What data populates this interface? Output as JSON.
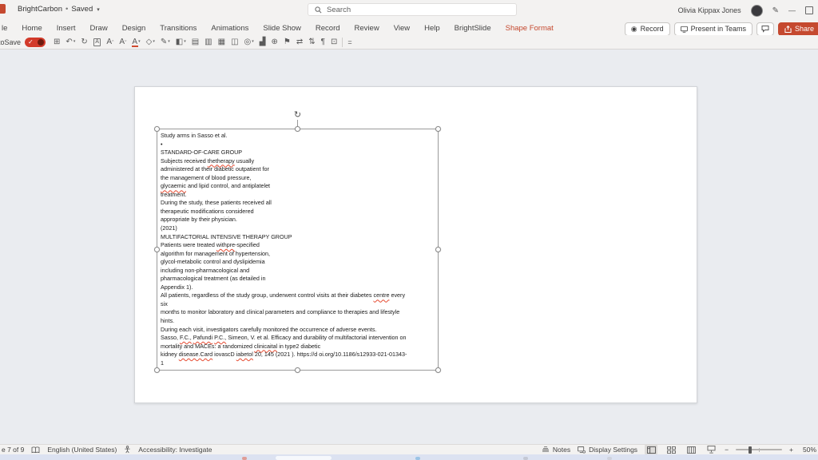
{
  "titlebar": {
    "doc_name": "BrightCarbon",
    "separator": "•",
    "saved_status": "Saved",
    "search_placeholder": "Search",
    "user_name": "Olivia Kippax Jones"
  },
  "ribbon": {
    "tabs": [
      {
        "label": "le",
        "name": "tab-file"
      },
      {
        "label": "Home",
        "name": "tab-home"
      },
      {
        "label": "Insert",
        "name": "tab-insert"
      },
      {
        "label": "Draw",
        "name": "tab-draw"
      },
      {
        "label": "Design",
        "name": "tab-design"
      },
      {
        "label": "Transitions",
        "name": "tab-transitions"
      },
      {
        "label": "Animations",
        "name": "tab-animations"
      },
      {
        "label": "Slide Show",
        "name": "tab-slide-show"
      },
      {
        "label": "Record",
        "name": "tab-record"
      },
      {
        "label": "Review",
        "name": "tab-review"
      },
      {
        "label": "View",
        "name": "tab-view"
      },
      {
        "label": "Help",
        "name": "tab-help"
      },
      {
        "label": "BrightSlide",
        "name": "tab-brightslide"
      },
      {
        "label": "Shape Format",
        "name": "tab-shape-format",
        "accent": true
      }
    ],
    "record_label": "Record",
    "present_label": "Present in Teams",
    "share_label": "Share"
  },
  "qat": {
    "autosave_label": "toSave",
    "overflow_glyph": "=",
    "icons": [
      {
        "name": "paste-icon",
        "glyph": "⊞"
      },
      {
        "name": "undo-icon",
        "glyph": "↶",
        "caret": true
      },
      {
        "name": "redo-icon",
        "glyph": "↻"
      },
      {
        "name": "text-box-icon",
        "glyph": "A",
        "boxed": true
      },
      {
        "name": "grow-font-icon",
        "glyph": "A",
        "sup": "ˆ"
      },
      {
        "name": "shrink-font-icon",
        "glyph": "A",
        "sup": "ˇ"
      },
      {
        "name": "font-color-icon",
        "glyph": "A",
        "bar": true,
        "caret": true
      },
      {
        "name": "change-shape-icon",
        "glyph": "◇",
        "caret": true
      },
      {
        "name": "shape-outline-icon",
        "glyph": "✎",
        "caret": true
      },
      {
        "name": "shape-fill-icon",
        "glyph": "◧",
        "caret": true
      },
      {
        "name": "bring-forward-icon",
        "glyph": "▤"
      },
      {
        "name": "send-backward-icon",
        "glyph": "▥"
      },
      {
        "name": "send-to-back-icon",
        "glyph": "▦"
      },
      {
        "name": "group-icon",
        "glyph": "◫"
      },
      {
        "name": "merge-shapes-icon",
        "glyph": "◎",
        "caret": true
      },
      {
        "name": "insert-chart-icon",
        "glyph": "▟"
      },
      {
        "name": "align-objects-icon",
        "glyph": "⊕"
      },
      {
        "name": "rotate-objects-icon",
        "glyph": "⚑"
      },
      {
        "name": "distribute-horizontal-icon",
        "glyph": "⇄"
      },
      {
        "name": "distribute-vertical-icon",
        "glyph": "⇅"
      },
      {
        "name": "text-direction-icon",
        "glyph": "¶"
      },
      {
        "name": "size-position-icon",
        "glyph": "⊡"
      }
    ]
  },
  "slide": {
    "textbox": {
      "lines": [
        "Study arms in Sasso et al.",
        "•",
        "STANDARD-OF-CARE GROUP",
        "Subjects received thetherapy usually",
        "administered at their diabetic outpatient for",
        "the management of blood pressure,",
        "glycaemic and lipid control, and antiplatelet",
        "treatment.",
        "During the study, these patients received all",
        "therapeutic modifications considered",
        "appropriate by their physician.",
        "(2021)",
        "MULTIFACTORIAL INTENSIVE THERAPY GROUP",
        "Patients were treated withpre-specified",
        "algorithm for management of hypertension,",
        "glycol-metabolic control and dyslipidemia",
        "including non-pharmacological and",
        "pharmacological treatment (as detailed in",
        "Appendix 1).",
        "All patients, regardless of the study group, underwent control visits at their diabetes centre every",
        "six",
        "months to monitor laboratory and clinical parameters and compliance to therapies and lifestyle",
        "hints.",
        "During each visit, investigators carefully monitored the occurrence of adverse events.",
        "Sasso, F.C., Pafundi P.C., Simeon, V. et al. Efficacy and durability of multifactorial intervention on",
        "mortality and MACEs: a randomized clinicaital in type2 diabetic",
        "kidney disease.Card iovascD iabetol 20, 145 (2021 ). https://d oi.org/10.1186/s12933-021-01343-",
        "1"
      ],
      "misspelled": [
        "thetherapy",
        "glycaemic",
        "withpre",
        "centre",
        "F.C.,",
        "Pafundi",
        "P.C.,",
        "clinicaital",
        "disease.Card",
        "iabetol"
      ]
    }
  },
  "statusbar": {
    "slide_indicator": "e 7 of 9",
    "language": "English (United States)",
    "accessibility": "Accessibility: Investigate",
    "notes_label": "Notes",
    "display_settings_label": "Display Settings",
    "zoom_level": "50%"
  },
  "colors": {
    "accent_red": "#c5492f",
    "autosave_toggle": "#d23a2a",
    "spellcheck_underline": "#e5492f"
  }
}
